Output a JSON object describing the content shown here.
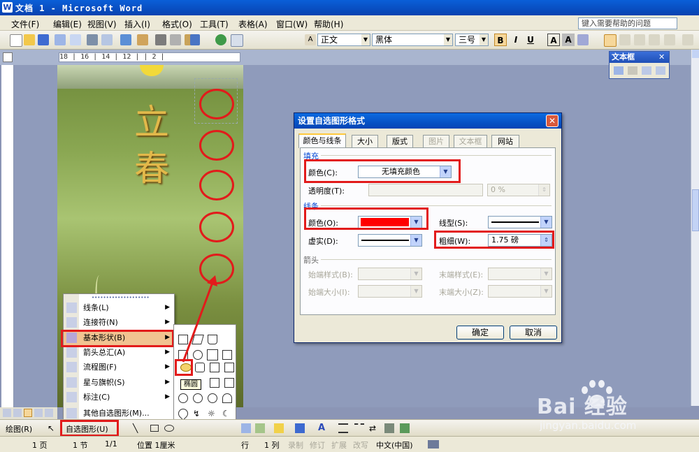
{
  "window": {
    "title": "文档 1 - Microsoft Word",
    "app_icon": "W"
  },
  "menu": [
    "文件(F)",
    "编辑(E)",
    "视图(V)",
    "插入(I)",
    "格式(O)",
    "工具(T)",
    "表格(A)",
    "窗口(W)",
    "帮助(H)"
  ],
  "help_search": "键入需要帮助的问题",
  "toolbar": {
    "style": "正文",
    "font": "黑体",
    "size": "三号",
    "bold": "B",
    "italic": "I",
    "underline": "U",
    "char_border": "A",
    "char_shade": "A"
  },
  "ruler": "18 | 16 | 14 | 12 |  | 2 |",
  "textbox_panel": {
    "title": "文本框"
  },
  "document": {
    "poem": [
      "立",
      "春"
    ]
  },
  "dialog": {
    "title": "设置自选图形格式",
    "tabs": [
      "颜色与线条",
      "大小",
      "版式",
      "图片",
      "文本框",
      "网站"
    ],
    "fill": {
      "section": "填充",
      "color_label": "颜色(C):",
      "color_value": "无填充颜色",
      "transparency_label": "透明度(T):",
      "transparency_value": "0 %"
    },
    "line": {
      "section": "线条",
      "color_label": "颜色(O):",
      "color_value": "#ff0000",
      "style_label": "线型(S):",
      "dash_label": "虚实(D):",
      "weight_label": "粗细(W):",
      "weight_value": "1.75 磅"
    },
    "arrows": {
      "section": "箭头",
      "begin_style": "始端样式(B):",
      "end_style": "末端样式(E):",
      "begin_size": "始端大小(I):",
      "end_size": "末端大小(Z):"
    },
    "ok": "确定",
    "cancel": "取消"
  },
  "autoshapes_menu": {
    "header": "••••••••••••••••••••",
    "items": [
      {
        "label": "线条(L)",
        "icon": "lines-icon"
      },
      {
        "label": "连接符(N)",
        "icon": "connector-icon"
      },
      {
        "label": "基本形状(B)",
        "icon": "basic-shapes-icon"
      },
      {
        "label": "箭头总汇(A)",
        "icon": "block-arrows-icon"
      },
      {
        "label": "流程图(F)",
        "icon": "flowchart-icon"
      },
      {
        "label": "星与旗帜(S)",
        "icon": "stars-banners-icon"
      },
      {
        "label": "标注(C)",
        "icon": "callouts-icon"
      },
      {
        "label": "其他自选图形(M)...",
        "icon": "more-shapes-icon"
      }
    ]
  },
  "tooltip": "椭圆",
  "drawbar": {
    "draw": "绘图(R)",
    "autoshapes": "自选图形(U)"
  },
  "status": {
    "page": "1 页",
    "section": "1 节",
    "pages": "1/1",
    "position": "位置 1厘米",
    "line": "行",
    "col": "1 列",
    "rec": "录制",
    "trk": "修订",
    "ext": "扩展",
    "ovr": "改写",
    "lang": "中文(中国)"
  },
  "watermark": {
    "brand": "Bai  经验",
    "url": "jingyan.baidu.com"
  }
}
